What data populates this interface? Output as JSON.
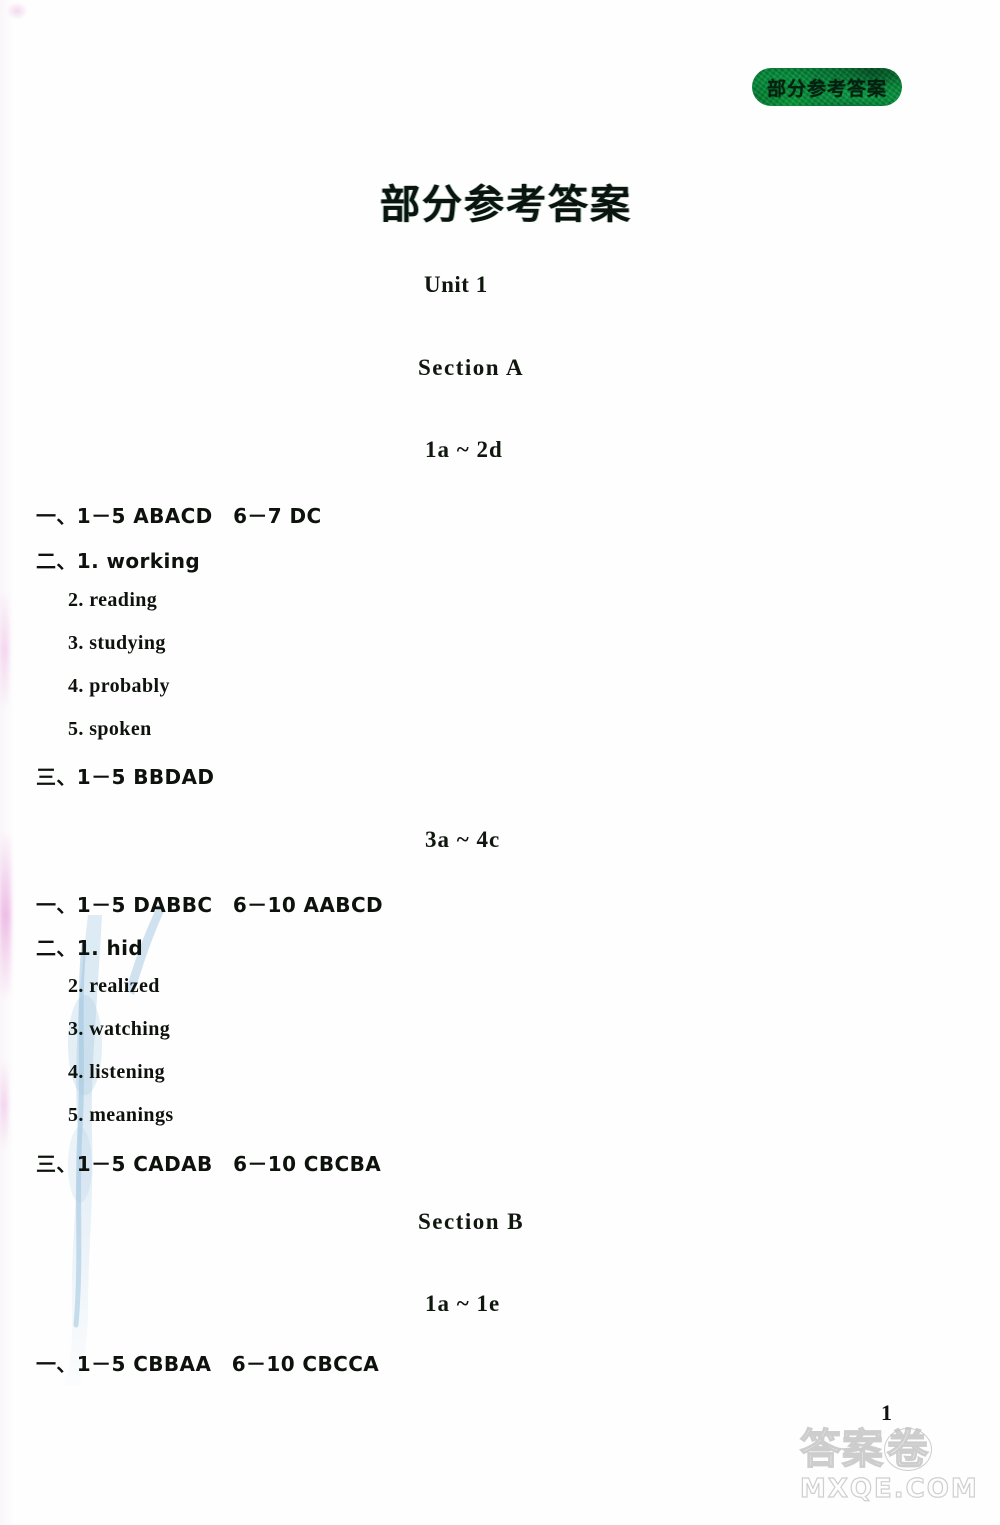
{
  "header": {
    "tab_label": "部分参考答案"
  },
  "title": "部分参考答案",
  "page_number": "1",
  "watermark": {
    "chinese_left": "答案",
    "chinese_circled": "卷",
    "url": "MXQE.COM"
  },
  "colors": {
    "tab_green": "#0d7c3a",
    "text_black": "#0d120c",
    "watermark_gray": "#c4c4c4",
    "artifact_blue": "#a9cbe4",
    "artifact_pink": "#e596d8"
  },
  "content": {
    "unit": "Unit 1",
    "sections": [
      {
        "name": "Section A",
        "groups": [
          {
            "range": "1a ~ 2d",
            "lines": [
              {
                "type": "numbered",
                "text": "一、1－5 ABACD　6－7 DC"
              },
              {
                "type": "numbered",
                "text": "二、1. working"
              },
              {
                "type": "sub",
                "text": "2. reading"
              },
              {
                "type": "sub",
                "text": "3. studying"
              },
              {
                "type": "sub",
                "text": "4. probably"
              },
              {
                "type": "sub",
                "text": "5. spoken"
              },
              {
                "type": "numbered",
                "text": "三、1－5 BBDAD"
              }
            ]
          },
          {
            "range": "3a ~ 4c",
            "lines": [
              {
                "type": "numbered",
                "text": "一、1－5 DABBC　6－10 AABCD"
              },
              {
                "type": "numbered",
                "text": "二、1. hid"
              },
              {
                "type": "sub",
                "text": "2. realized"
              },
              {
                "type": "sub",
                "text": "3. watching"
              },
              {
                "type": "sub",
                "text": "4. listening"
              },
              {
                "type": "sub",
                "text": "5. meanings"
              },
              {
                "type": "numbered",
                "text": "三、1－5 CADAB　6－10 CBCBA"
              }
            ]
          }
        ]
      },
      {
        "name": "Section B",
        "groups": [
          {
            "range": "1a ~ 1e",
            "lines": [
              {
                "type": "numbered",
                "text": "一、1－5 CBBAA　6－10 CBCCA"
              }
            ]
          }
        ]
      }
    ]
  }
}
